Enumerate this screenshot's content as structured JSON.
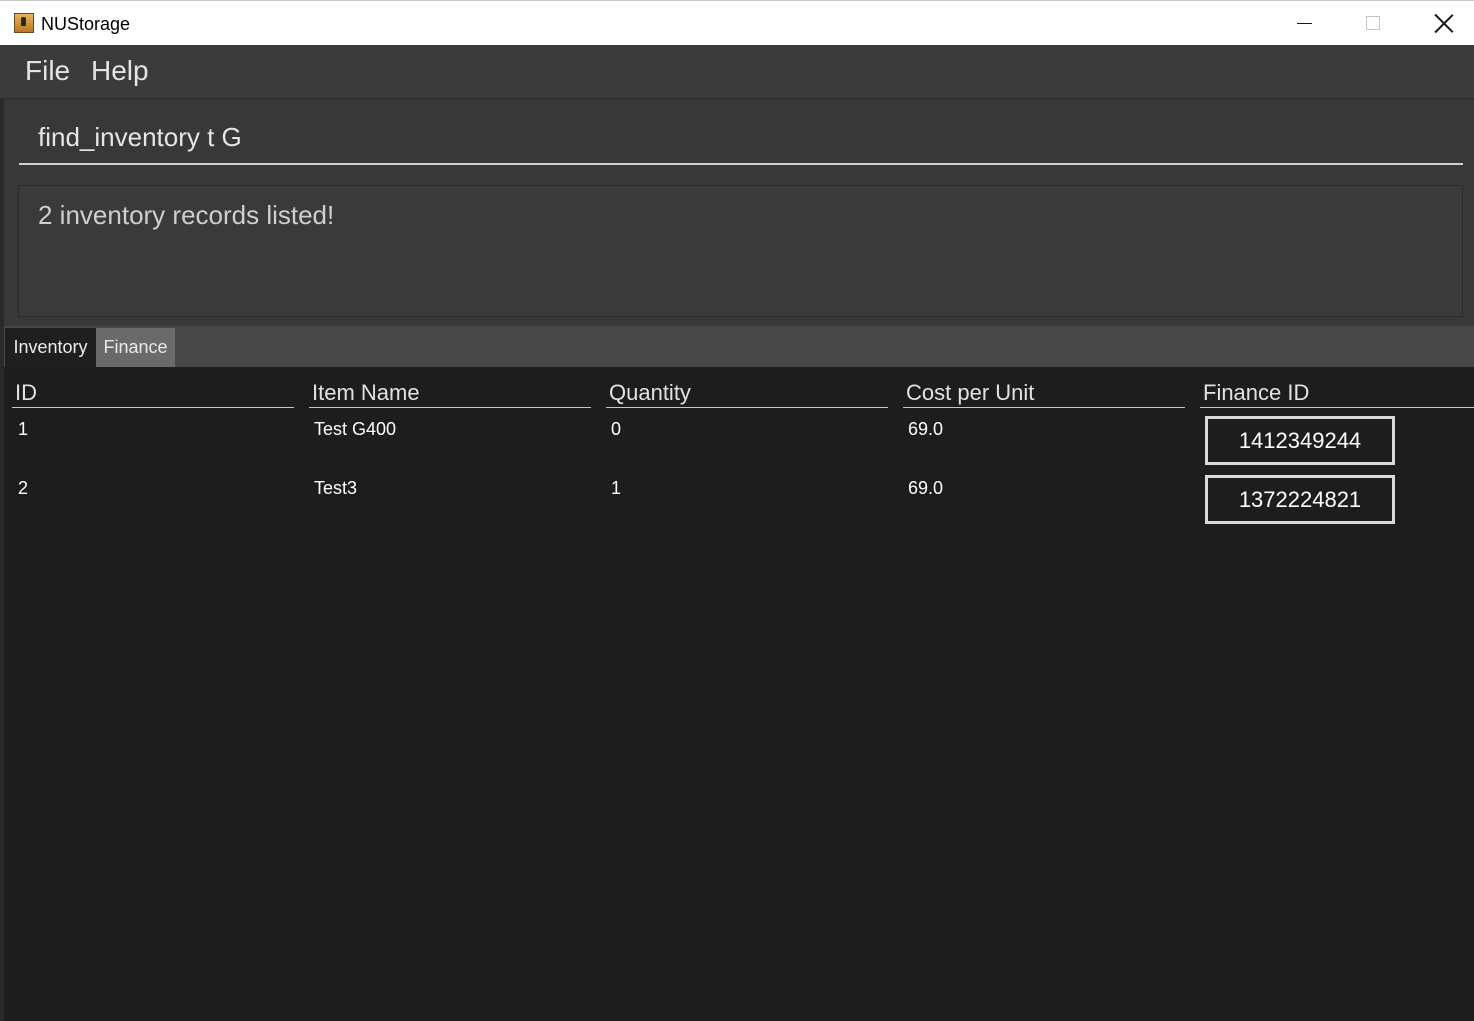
{
  "window": {
    "title": "NUStorage",
    "icon": "app-icon"
  },
  "menu": {
    "items": [
      "File",
      "Help"
    ]
  },
  "command": {
    "value": "find_inventory t G"
  },
  "result": {
    "message": "2 inventory records listed!"
  },
  "tabs": [
    {
      "label": "Inventory",
      "selected": true
    },
    {
      "label": "Finance",
      "selected": false
    }
  ],
  "table": {
    "columns": [
      "ID",
      "Item Name",
      "Quantity",
      "Cost per Unit",
      "Finance ID"
    ],
    "rows": [
      {
        "id": "1",
        "name": "Test G400",
        "quantity": "0",
        "cost": "69.0",
        "finance_id": "1412349244"
      },
      {
        "id": "2",
        "name": "Test3",
        "quantity": "1",
        "cost": "69.0",
        "finance_id": "1372224821"
      }
    ]
  },
  "colors": {
    "background": "#1d1d1d",
    "panel": "#383838",
    "menubar": "#3b3b3b",
    "tab_unselected": "#6a6a6a"
  }
}
